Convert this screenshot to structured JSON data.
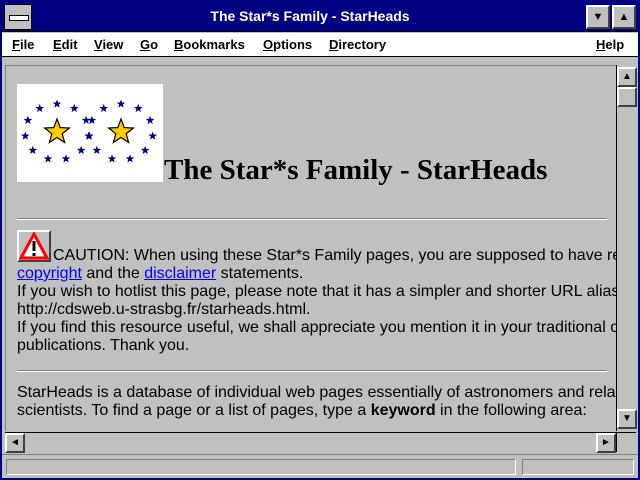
{
  "window": {
    "title": "The Star*s Family - StarHeads"
  },
  "titlebar": {
    "minimize_glyph": "▼",
    "maximize_glyph": "▲"
  },
  "menu": {
    "items": [
      {
        "mnemonic": "F",
        "rest": "ile"
      },
      {
        "mnemonic": "E",
        "rest": "dit"
      },
      {
        "mnemonic": "V",
        "rest": "iew"
      },
      {
        "mnemonic": "G",
        "rest": "o"
      },
      {
        "mnemonic": "B",
        "rest": "ookmarks"
      },
      {
        "mnemonic": "O",
        "rest": "ptions"
      },
      {
        "mnemonic": "D",
        "rest": "irectory"
      },
      {
        "mnemonic": "H",
        "rest": "elp"
      }
    ]
  },
  "page": {
    "heading": "The Star*s Family - StarHeads",
    "caution": {
      "line1": "CAUTION: When using these Star*s Family pages, you are supposed to have read the",
      "link_copyright": "copyright",
      "and_the": " and the ",
      "link_disclaimer": "disclaimer",
      "statements": " statements.",
      "hotlist": "If you wish to hotlist this page, please note that it has a simpler and shorter URL alias:",
      "alias_url": "http://cdsweb.u-strasbg.fr/starheads.html.",
      "useful1": "If you find this resource useful, we shall appreciate you mention it in your traditional or electronic",
      "useful2": "publications. Thank you."
    },
    "intro": {
      "line1": "StarHeads is a database of individual web pages essentially of astronomers and related space",
      "line2_pre": "scientists. To find a page or a list of pages, type a ",
      "keyword": "keyword",
      "line2_post": " in the following area:"
    }
  },
  "scrollbars": {
    "up": "▲",
    "down": "▼",
    "left": "◄",
    "right": "►"
  },
  "colors": {
    "titlebar": "#000080",
    "link": "#0000ff",
    "star_blue": "#000080",
    "star_gold": "#ffcc00",
    "caution_red": "#ff0000"
  },
  "icons": {
    "logo": "stars-logo-icon",
    "caution": "caution-triangle-icon"
  }
}
